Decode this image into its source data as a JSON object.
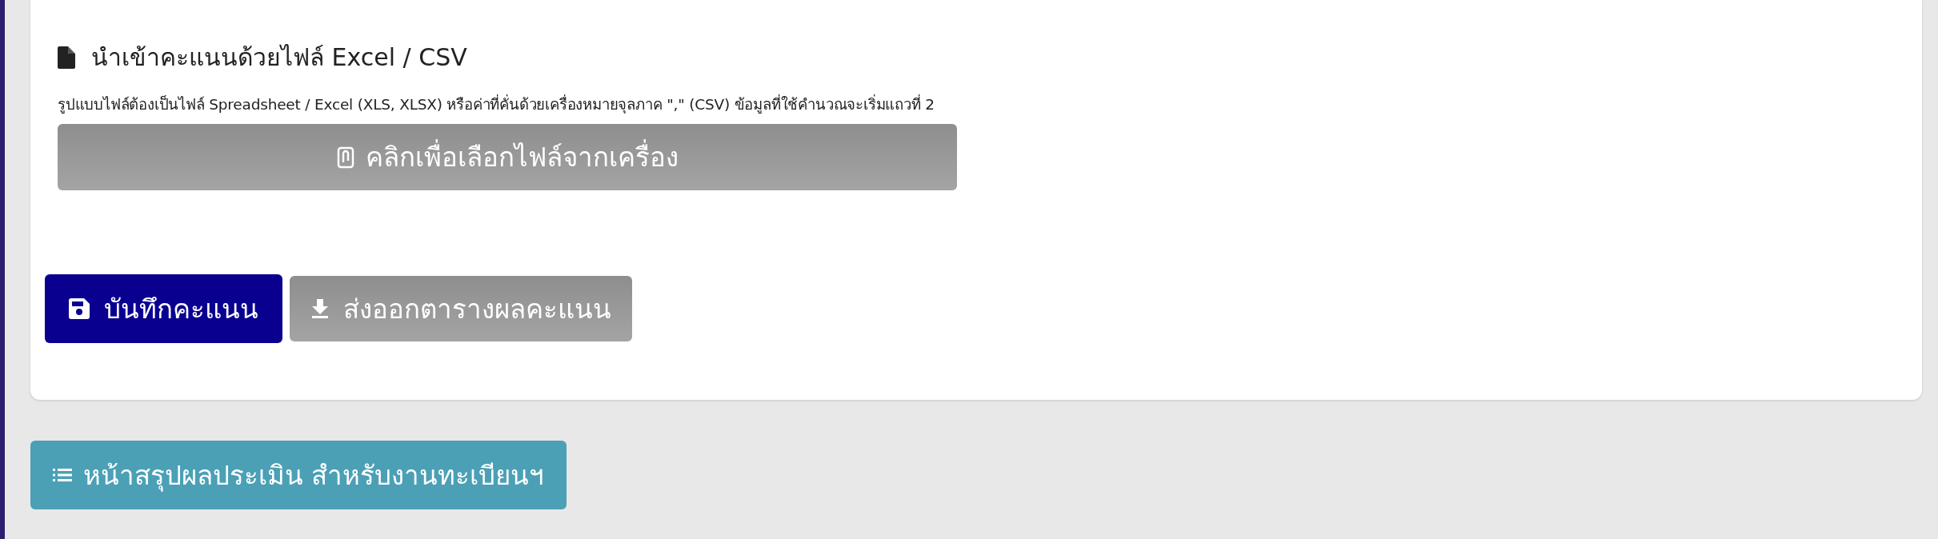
{
  "import_section": {
    "title": "นำเข้าคะแนนด้วยไฟล์ Excel / CSV",
    "description": "รูปแบบไฟล์ต้องเป็นไฟล์ Spreadsheet / Excel (XLS, XLSX) หรือค่าที่คั่นด้วยเครื่องหมายจุลภาค \",\" (CSV) ข้อมูลที่ใช้คำนวณจะเริ่มแถวที่ 2",
    "file_button": "คลิกเพื่อเลือกไฟล์จากเครื่อง"
  },
  "actions": [
    {
      "kind": "save",
      "label": "บันทึกคะแนน"
    },
    {
      "kind": "export",
      "label": "ส่งออกตารางผลคะแนน"
    }
  ],
  "summary_button": "หน้าสรุปผลประเมิน สำหรับงานทะเบียนฯ"
}
